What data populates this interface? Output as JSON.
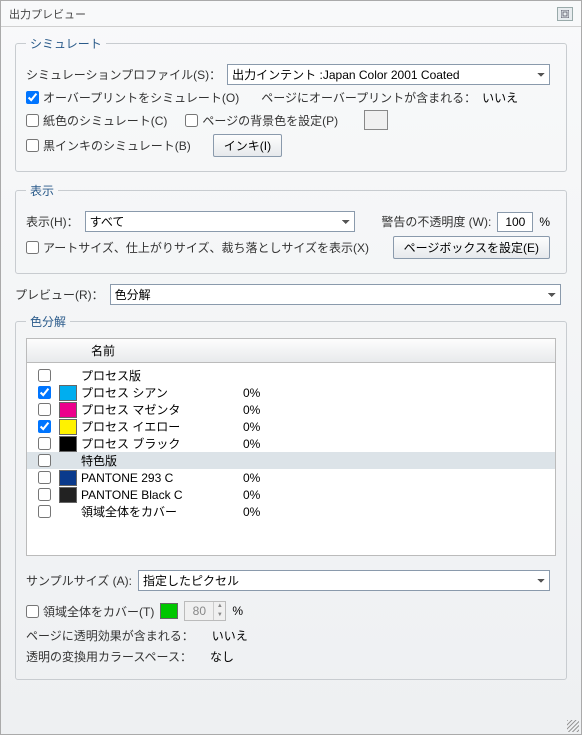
{
  "title": "出力プレビュー",
  "simulate": {
    "legend": "シミュレート",
    "profile_label": "シミュレーションプロファイル(S)：",
    "profile_value": "出力インテント :Japan Color 2001 Coated",
    "overprint_label": "オーバープリントをシミュレート(O)",
    "overprint_contains_label": "ページにオーバープリントが含まれる：",
    "overprint_contains_value": "いいえ",
    "paper_label": "紙色のシミュレート(C)",
    "bgcolor_label": "ページの背景色を設定(P)",
    "blackink_label": "黒インキのシミュレート(B)",
    "ink_btn": "インキ(I)"
  },
  "display": {
    "legend": "表示",
    "show_label": "表示(H)：",
    "show_value": "すべて",
    "warn_label": "警告の不透明度 (W):",
    "warn_value": "100",
    "percent": "%",
    "artsize_label": "アートサイズ、仕上がりサイズ、裁ち落としサイズを表示(X)",
    "pagebox_btn": "ページボックスを設定(E)"
  },
  "preview": {
    "label": "プレビュー(R)：",
    "value": "色分解"
  },
  "separations": {
    "legend": "色分解",
    "header_name": "名前",
    "rows": [
      {
        "checked": false,
        "color": null,
        "name": "プロセス版",
        "value": ""
      },
      {
        "checked": true,
        "color": "#00AEEF",
        "name": "プロセス シアン",
        "value": "0%"
      },
      {
        "checked": false,
        "color": "#EC008C",
        "name": "プロセス マゼンタ",
        "value": "0%"
      },
      {
        "checked": true,
        "color": "#FFF200",
        "name": "プロセス イエロー",
        "value": "0%"
      },
      {
        "checked": false,
        "color": "#000000",
        "name": "プロセス ブラック",
        "value": "0%"
      },
      {
        "checked": false,
        "color": null,
        "name": "特色版",
        "value": "",
        "sel": true
      },
      {
        "checked": false,
        "color": "#0A3A8C",
        "name": "PANTONE 293 C",
        "value": "0%"
      },
      {
        "checked": false,
        "color": "#222222",
        "name": "PANTONE Black C",
        "value": "0%"
      },
      {
        "checked": false,
        "color": null,
        "name": "領域全体をカバー",
        "value": "0%"
      }
    ]
  },
  "sample": {
    "label": "サンプルサイズ (A):",
    "value": "指定したピクセル"
  },
  "cover": {
    "label": "領域全体をカバー(T)",
    "color": "#00c700",
    "value": "80",
    "percent": "%"
  },
  "transparent_contains_label": "ページに透明効果が含まれる：",
  "transparent_contains_value": "いいえ",
  "transparent_space_label": "透明の変換用カラースペース：",
  "transparent_space_value": "なし"
}
